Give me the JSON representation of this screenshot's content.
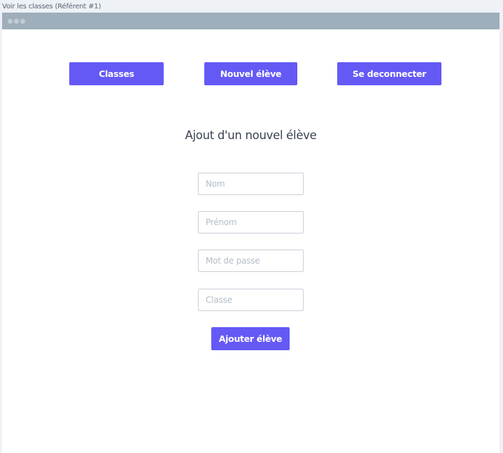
{
  "frame": {
    "title": "Voir les classes (Référent #1)"
  },
  "nav": {
    "classes_label": "Classes",
    "new_student_label": "Nouvel élève",
    "logout_label": "Se deconnecter"
  },
  "form": {
    "title": "Ajout d'un nouvel élève",
    "fields": {
      "nom": {
        "placeholder": "Nom",
        "value": ""
      },
      "prenom": {
        "placeholder": "Prénom",
        "value": ""
      },
      "password": {
        "placeholder": "Mot de passe",
        "value": ""
      },
      "classe": {
        "placeholder": "Classe",
        "value": ""
      }
    },
    "submit_label": "Ajouter élève"
  },
  "colors": {
    "accent": "#6559f5",
    "window_bar": "#9eaebb",
    "background": "#eef1f5"
  }
}
